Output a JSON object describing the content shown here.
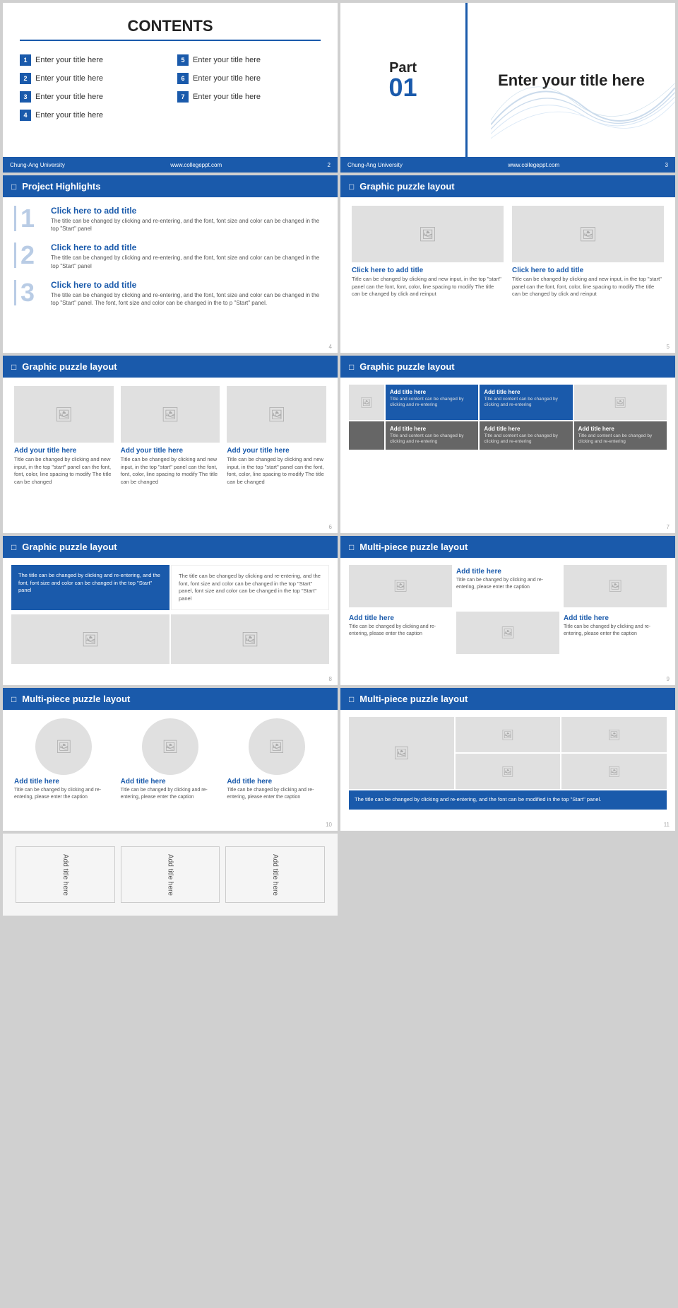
{
  "slides": {
    "slide2": {
      "title": "CONTENTS",
      "items": [
        {
          "num": "1",
          "label": "Enter your title here"
        },
        {
          "num": "2",
          "label": "Enter your title here"
        },
        {
          "num": "3",
          "label": "Enter your title here"
        },
        {
          "num": "4",
          "label": "Enter your title here"
        },
        {
          "num": "5",
          "label": "Enter your title here"
        },
        {
          "num": "6",
          "label": "Enter your title here"
        },
        {
          "num": "7",
          "label": "Enter your title here"
        }
      ],
      "footer_left": "Chung-Ang University",
      "footer_right": "www.collegeppt.com",
      "page": "2"
    },
    "slide3": {
      "part_label": "Part",
      "part_num": "01",
      "part_title": "Enter your title here",
      "footer_left": "Chung-Ang University",
      "footer_right": "www.collegeppt.com",
      "page": "3"
    },
    "slide4": {
      "section": "Project Highlights",
      "items": [
        {
          "num": "1",
          "title": "Click here to add title",
          "text": "The title can be changed by clicking and re-entering, and the font, font size and color can be changed in the top \"Start\" panel"
        },
        {
          "num": "2",
          "title": "Click here to add title",
          "text": "The title can be changed by clicking and re-entering, and the font, font size and color can be changed in the top \"Start\" panel"
        },
        {
          "num": "3",
          "title": "Click here to add title",
          "text": "The title can be changed by clicking and re-entering, and the font, font size and color can be changed in the top \"Start\" panel. The font, font size and color can be changed in the to p \"Start\" panel."
        }
      ],
      "page": "4"
    },
    "slide5": {
      "section": "Graphic puzzle layout",
      "items": [
        {
          "title": "Click here to add title",
          "text": "Title can be changed by clicking and new input, in the top \"start\" panel can the font, font, color, line spacing to modify The title can be changed by click and reinput"
        },
        {
          "title": "Click here to add title",
          "text": "Title can be changed by clicking and new input, in the top \"start\" panel can the font, font, color, line spacing to modify The title can be changed by click and reinput"
        }
      ],
      "page": "5"
    },
    "slide6": {
      "section": "Graphic puzzle layout",
      "items": [
        {
          "title": "Add your title here",
          "text": "Title can be changed by clicking and new input, in the top \"start\" panel can the font, font, color, line spacing to modify The title can be changed"
        },
        {
          "title": "Add your title here",
          "text": "Title can be changed by clicking and new input, in the top \"start\" panel can the font, font, color, line spacing to modify The title can be changed"
        },
        {
          "title": "Add your title here",
          "text": "Title can be changed by clicking and new input, in the top \"start\" panel can the font, font, color, line spacing to modify The title can be changed"
        }
      ],
      "page": "6"
    },
    "slide7": {
      "section": "Graphic puzzle layout",
      "grid_items": [
        {
          "title": "Add title here",
          "text": "Title and content can be changed by clicking and re-entering",
          "type": "blue"
        },
        {
          "title": "Add title here",
          "text": "Title and content can be changed by clicking and re-entering",
          "type": "blue"
        },
        {
          "type": "img"
        },
        {
          "title": "Add title here",
          "text": "Title and content can be changed by clicking and re-entering",
          "type": "dark"
        },
        {
          "title": "Add title here",
          "text": "Title and content can be changed by clicking and re-entering",
          "type": "dark"
        },
        {
          "title": "Add title here",
          "text": "Title and content can be changed by clicking and re-entering",
          "type": "dark"
        }
      ],
      "page": "7"
    },
    "slide8": {
      "section": "Graphic puzzle layout",
      "text_left": "The title can be changed by clicking and re-entering, and the font, font size and color can be changed in the top \"Start\" panel",
      "text_right": "The title can be changed by clicking and re-entering, and the font, font size and color can be changed in the top \"Start\" panel, font size and color can be changed in the top \"Start\" panel",
      "page": "8"
    },
    "slide9": {
      "section": "Multi-piece puzzle layout",
      "items": [
        {
          "title": "Add title here",
          "text": "Title can be changed by clicking and re-entering, please enter the caption"
        },
        {
          "title": "Add title here",
          "text": "Title can be changed by clicking and re-entering, please enter the caption"
        },
        {
          "title": "Add title here",
          "text": "Title can be changed by clicking and re-entering, please enter the caption"
        }
      ],
      "page": "9"
    },
    "slide10": {
      "section": "Multi-piece puzzle layout",
      "items": [
        {
          "title": "Add title here",
          "text": "Title can be changed by clicking and re-entering, please enter the caption"
        },
        {
          "title": "Add title here",
          "text": "Title can be changed by clicking and re-entering, please enter the caption"
        },
        {
          "title": "Add title here",
          "text": "Title can be changed by clicking and re-entering, please enter the caption"
        }
      ],
      "page": "10"
    },
    "slide11": {
      "section": "Multi-piece puzzle layout",
      "bottom_text": "The title can be changed by clicking and re-entering, and the font can be modified in the top \"Start\" panel.",
      "page": "11"
    },
    "bottom_labels": {
      "slide_bottom_left": [
        {
          "label": "Add title here"
        },
        {
          "label": "Add title here"
        },
        {
          "label": "Add title here"
        }
      ]
    }
  }
}
